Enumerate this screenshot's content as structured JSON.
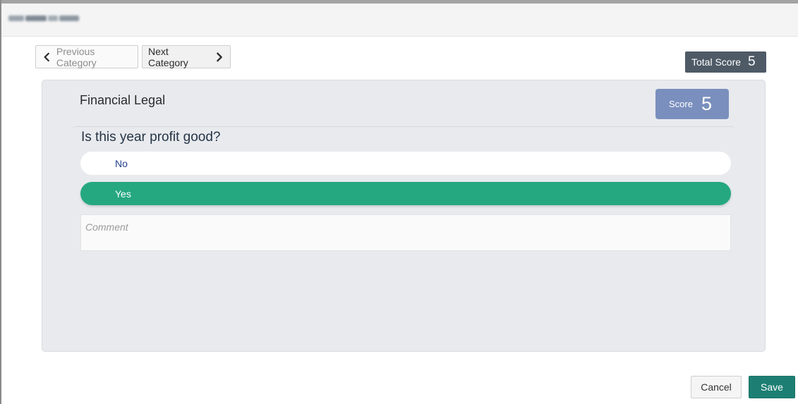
{
  "header": {
    "title_redacted": "blurred-title"
  },
  "navigation": {
    "previous_label": "Previous Category",
    "next_label": "Next Category",
    "previous_icon": "chevron-left-icon",
    "next_icon": "chevron-right-icon"
  },
  "total_score": {
    "label": "Total Score",
    "value": "5"
  },
  "category": {
    "title": "Financial Legal",
    "score_label": "Score",
    "score_value": "5"
  },
  "question": {
    "text": "Is this year profit good?",
    "options": [
      {
        "label": "No",
        "selected": false
      },
      {
        "label": "Yes",
        "selected": true
      }
    ],
    "comment_placeholder": "Comment"
  },
  "footer": {
    "cancel_label": "Cancel",
    "save_label": "Save"
  },
  "colors": {
    "selected_option": "#25a87f",
    "score_badge": "#7a8fbd",
    "total_score_badge": "#4e5a66",
    "save_button": "#1d7f73",
    "panel_background": "#e8eaee"
  }
}
